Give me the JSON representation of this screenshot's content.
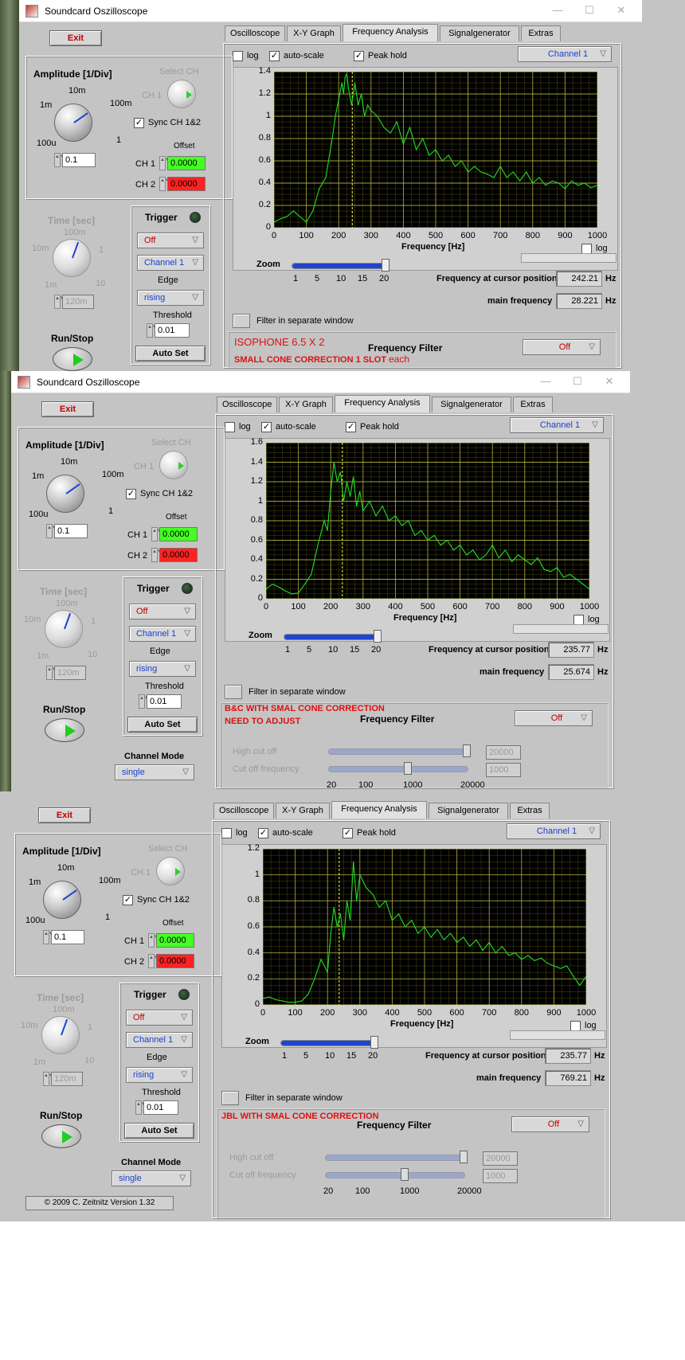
{
  "window": {
    "title": "Soundcard Oszilloscope",
    "min": "—",
    "max": "☐",
    "close": "✕"
  },
  "colors": {
    "trace": "#22dd22",
    "grid": "#c8c840",
    "cursor": "#ffff44",
    "note": "#dd1111",
    "accent": "#2244cc"
  },
  "icons": [
    "app-icon",
    "chevron-down-icon",
    "play-icon",
    "spin-arrows-icon"
  ],
  "common": {
    "exit": "Exit",
    "amplitude_title": "Amplitude [1/Div]",
    "amp_ticks": [
      "10m",
      "100m",
      "1m",
      "1",
      "100u"
    ],
    "amp_value": "0.1",
    "select_ch": "Select CH",
    "ch1_label": "CH 1",
    "sync": "Sync CH 1&2",
    "offset": "Offset",
    "ch1": "CH 1",
    "ch2": "CH 2",
    "ch1_offset": "0.0000",
    "ch2_offset": "0.0000",
    "time_title": "Time [sec]",
    "time_ticks": [
      "100m",
      "10m",
      "1",
      "1m",
      "10"
    ],
    "time_value": "120m",
    "trigger": "Trigger",
    "trig_mode": "Off",
    "trig_channel": "Channel 1",
    "edge": "Edge",
    "edge_value": "rising",
    "threshold": "Threshold",
    "threshold_value": "0.01",
    "autoset": "Auto Set",
    "runstop": "Run/Stop",
    "channel_mode": "Channel Mode",
    "channel_mode_value": "single",
    "tabs": [
      "Oscilloscope",
      "X-Y Graph",
      "Frequency Analysis",
      "Signalgenerator",
      "Extras"
    ],
    "log": "log",
    "autoscale": "auto-scale",
    "peakhold": "Peak hold",
    "channel_dd": "Channel 1",
    "xlabel": "Frequency [Hz]",
    "xticks": [
      "0",
      "100",
      "200",
      "300",
      "400",
      "500",
      "600",
      "700",
      "800",
      "900",
      "1000"
    ],
    "zoom": "Zoom",
    "zoom_ticks": [
      "1",
      "5",
      "10",
      "15",
      "20"
    ],
    "cursor_label": "Frequency at cursor position",
    "main_label": "main frequency",
    "hz": "Hz",
    "filter_window": "Filter in separate window",
    "freq_filter": "Frequency Filter",
    "filter_mode": "Off",
    "high_cut": "High cut off",
    "cut_freq": "Cut off frequency",
    "high_cut_value": "20000",
    "cut_freq_value": "1000",
    "filter_ticks": [
      "20",
      "100",
      "1000",
      "20000"
    ],
    "copyright": "© 2009  C. Zeitnitz Version 1.32"
  },
  "panels": [
    {
      "cursor_freq": "242.21",
      "main_freq": "28.221",
      "note1": "ISOPHONE 6.5 X 2",
      "note2": "SMALL CONE CORRECTION 1 SLOT",
      "note3": "each"
    },
    {
      "cursor_freq": "235.77",
      "main_freq": "25.674",
      "note1": "B&C WITH SMAL CONE CORRECTION",
      "note2": "NEED TO ADJUST"
    },
    {
      "cursor_freq": "235.77",
      "main_freq": "769.21",
      "note1": "JBL WITH SMAL CONE CORRECTION"
    }
  ],
  "chart_data": [
    {
      "type": "line",
      "xlabel": "Frequency [Hz]",
      "xlim": [
        0,
        1000
      ],
      "ylim": [
        0,
        1.4
      ],
      "yticks": [
        "0",
        "0.2",
        "0.4",
        "0.6",
        "0.8",
        "1",
        "1.2",
        "1.4"
      ],
      "cursor_x": 242,
      "x": [
        0,
        20,
        40,
        60,
        80,
        100,
        120,
        140,
        160,
        180,
        190,
        200,
        210,
        215,
        220,
        225,
        230,
        240,
        250,
        260,
        270,
        280,
        290,
        300,
        320,
        340,
        360,
        380,
        400,
        420,
        440,
        460,
        480,
        500,
        520,
        540,
        560,
        580,
        600,
        620,
        640,
        660,
        680,
        700,
        720,
        740,
        760,
        780,
        800,
        820,
        840,
        860,
        880,
        900,
        920,
        940,
        960,
        980,
        1000
      ],
      "values": [
        0.05,
        0.08,
        0.1,
        0.15,
        0.1,
        0.05,
        0.15,
        0.35,
        0.45,
        0.8,
        1.0,
        1.15,
        1.3,
        1.2,
        1.35,
        1.38,
        1.25,
        1.1,
        1.3,
        1.1,
        1.2,
        1.0,
        1.1,
        1.05,
        1.0,
        0.9,
        0.85,
        0.95,
        0.75,
        0.9,
        0.7,
        0.8,
        0.65,
        0.7,
        0.6,
        0.65,
        0.55,
        0.6,
        0.5,
        0.55,
        0.5,
        0.48,
        0.45,
        0.55,
        0.45,
        0.5,
        0.42,
        0.5,
        0.4,
        0.45,
        0.38,
        0.42,
        0.4,
        0.35,
        0.42,
        0.38,
        0.4,
        0.36,
        0.38
      ]
    },
    {
      "type": "line",
      "xlabel": "Frequency [Hz]",
      "xlim": [
        0,
        1000
      ],
      "ylim": [
        0,
        1.6
      ],
      "yticks": [
        "0",
        "0.2",
        "0.4",
        "0.6",
        "0.8",
        "1",
        "1.2",
        "1.4",
        "1.6"
      ],
      "cursor_x": 236,
      "x": [
        0,
        20,
        40,
        60,
        80,
        100,
        120,
        140,
        160,
        180,
        190,
        200,
        210,
        220,
        230,
        240,
        250,
        260,
        270,
        280,
        290,
        300,
        320,
        340,
        360,
        380,
        400,
        420,
        440,
        460,
        480,
        500,
        520,
        540,
        560,
        580,
        600,
        620,
        640,
        660,
        680,
        700,
        720,
        740,
        760,
        780,
        800,
        820,
        840,
        860,
        880,
        900,
        920,
        940,
        960,
        980,
        1000
      ],
      "values": [
        0.1,
        0.15,
        0.12,
        0.08,
        0.05,
        0.06,
        0.15,
        0.25,
        0.55,
        0.8,
        0.7,
        1.1,
        1.4,
        1.2,
        1.3,
        1.0,
        1.2,
        1.05,
        1.25,
        0.95,
        1.1,
        0.9,
        1.0,
        0.85,
        0.95,
        0.8,
        0.85,
        0.75,
        0.8,
        0.65,
        0.7,
        0.6,
        0.65,
        0.55,
        0.6,
        0.5,
        0.55,
        0.45,
        0.5,
        0.4,
        0.45,
        0.55,
        0.42,
        0.5,
        0.38,
        0.45,
        0.4,
        0.35,
        0.42,
        0.3,
        0.28,
        0.32,
        0.22,
        0.25,
        0.2,
        0.15,
        0.1
      ]
    },
    {
      "type": "line",
      "xlabel": "Frequency [Hz]",
      "xlim": [
        0,
        1000
      ],
      "ylim": [
        0,
        1.2
      ],
      "yticks": [
        "0",
        "0.2",
        "0.4",
        "0.6",
        "0.8",
        "1",
        "1.2"
      ],
      "cursor_x": 236,
      "x": [
        0,
        20,
        40,
        60,
        80,
        100,
        120,
        140,
        160,
        180,
        200,
        210,
        220,
        230,
        240,
        250,
        260,
        270,
        280,
        290,
        300,
        320,
        340,
        360,
        380,
        400,
        420,
        440,
        460,
        480,
        500,
        520,
        540,
        560,
        580,
        600,
        620,
        640,
        660,
        680,
        700,
        720,
        740,
        760,
        780,
        800,
        820,
        840,
        860,
        880,
        900,
        920,
        940,
        960,
        980,
        1000
      ],
      "values": [
        0.05,
        0.06,
        0.04,
        0.03,
        0.02,
        0.02,
        0.03,
        0.08,
        0.2,
        0.35,
        0.25,
        0.55,
        0.75,
        0.6,
        0.7,
        0.5,
        0.8,
        0.65,
        1.1,
        0.8,
        1.0,
        0.9,
        0.85,
        0.75,
        0.8,
        0.65,
        0.7,
        0.6,
        0.65,
        0.55,
        0.6,
        0.52,
        0.58,
        0.5,
        0.55,
        0.48,
        0.52,
        0.45,
        0.5,
        0.42,
        0.48,
        0.4,
        0.45,
        0.38,
        0.4,
        0.35,
        0.38,
        0.34,
        0.36,
        0.32,
        0.3,
        0.28,
        0.3,
        0.22,
        0.15,
        0.22
      ]
    }
  ]
}
